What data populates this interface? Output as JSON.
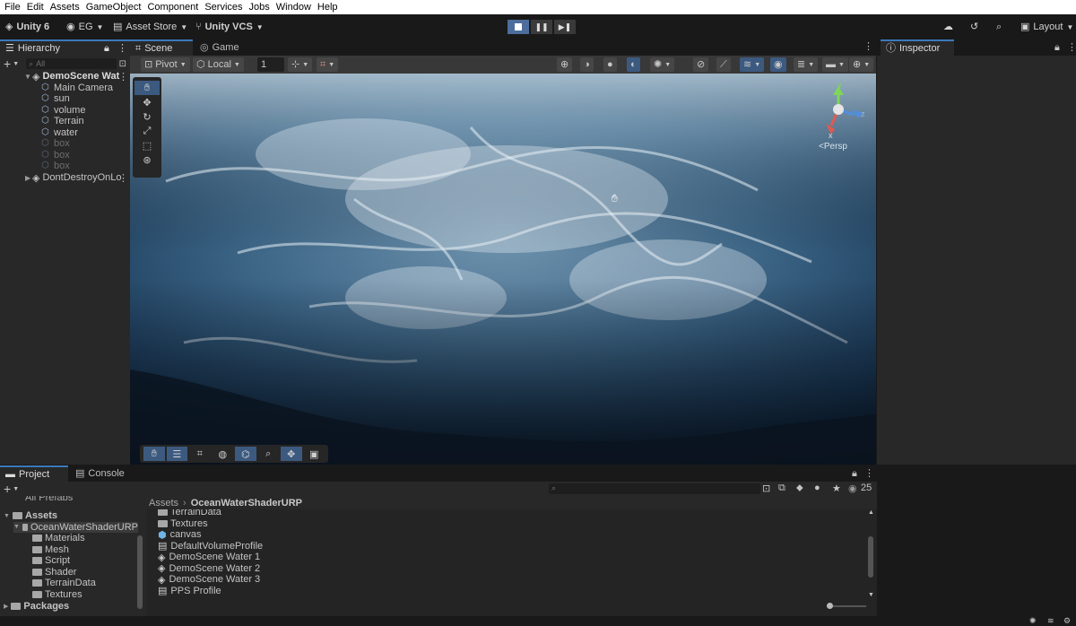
{
  "menu": [
    "File",
    "Edit",
    "Assets",
    "GameObject",
    "Component",
    "Services",
    "Jobs",
    "Window",
    "Help"
  ],
  "toolbar": {
    "unity_label": "Unity 6",
    "account_label": "EG",
    "asset_store_label": "Asset Store",
    "vcs_label": "Unity VCS",
    "layout_label": "Layout",
    "play_icons": [
      "▶",
      "❚❚",
      "▶❚"
    ]
  },
  "hierarchy": {
    "tab": "Hierarchy",
    "search_placeholder": "All",
    "root_scene": "DemoScene Wat",
    "children": [
      {
        "label": "Main Camera",
        "dim": false
      },
      {
        "label": "sun",
        "dim": false
      },
      {
        "label": "volume",
        "dim": false
      },
      {
        "label": "Terrain",
        "dim": false
      },
      {
        "label": "water",
        "dim": false
      },
      {
        "label": "box",
        "dim": true
      },
      {
        "label": "box",
        "dim": true
      },
      {
        "label": "box",
        "dim": true
      }
    ],
    "dontdestroy": "DontDestroyOnLo"
  },
  "scene": {
    "tab_scene": "Scene",
    "tab_game": "Game",
    "pivot_label": "Pivot",
    "local_label": "Local",
    "grid_value": "1",
    "persp_label": "<Persp",
    "axis_y": "y",
    "axis_z": "z",
    "axis_x": "x"
  },
  "inspector": {
    "tab": "Inspector"
  },
  "project": {
    "tab_project": "Project",
    "tab_console": "Console",
    "count": "25",
    "clipped_top": "All Prefabs",
    "tree": [
      {
        "label": "Assets",
        "level": 0,
        "bold": true
      },
      {
        "label": "OceanWaterShaderURP",
        "level": 1,
        "bold": false,
        "selected": true
      },
      {
        "label": "Materials",
        "level": 2,
        "bold": false
      },
      {
        "label": "Mesh",
        "level": 2,
        "bold": false
      },
      {
        "label": "Script",
        "level": 2,
        "bold": false
      },
      {
        "label": "Shader",
        "level": 2,
        "bold": false
      },
      {
        "label": "TerrainData",
        "level": 2,
        "bold": false
      },
      {
        "label": "Textures",
        "level": 2,
        "bold": false
      },
      {
        "label": "Packages",
        "level": 0,
        "bold": true
      }
    ],
    "breadcrumb_root": "Assets",
    "breadcrumb_current": "OceanWaterShaderURP",
    "files": [
      {
        "label": "TerrainData",
        "icon": "folder"
      },
      {
        "label": "Textures",
        "icon": "folder"
      },
      {
        "label": "canvas",
        "icon": "prefab"
      },
      {
        "label": "DefaultVolumeProfile",
        "icon": "asset"
      },
      {
        "label": "DemoScene Water 1",
        "icon": "scene"
      },
      {
        "label": "DemoScene Water 2",
        "icon": "scene"
      },
      {
        "label": "DemoScene Water 3",
        "icon": "scene"
      },
      {
        "label": "PPS Profile",
        "icon": "asset"
      }
    ]
  },
  "colors": {
    "accent": "#3a79bb",
    "panel": "#282828",
    "bg": "#191919",
    "water_deep": "#0f2438",
    "water_light": "#d8e6ee"
  }
}
